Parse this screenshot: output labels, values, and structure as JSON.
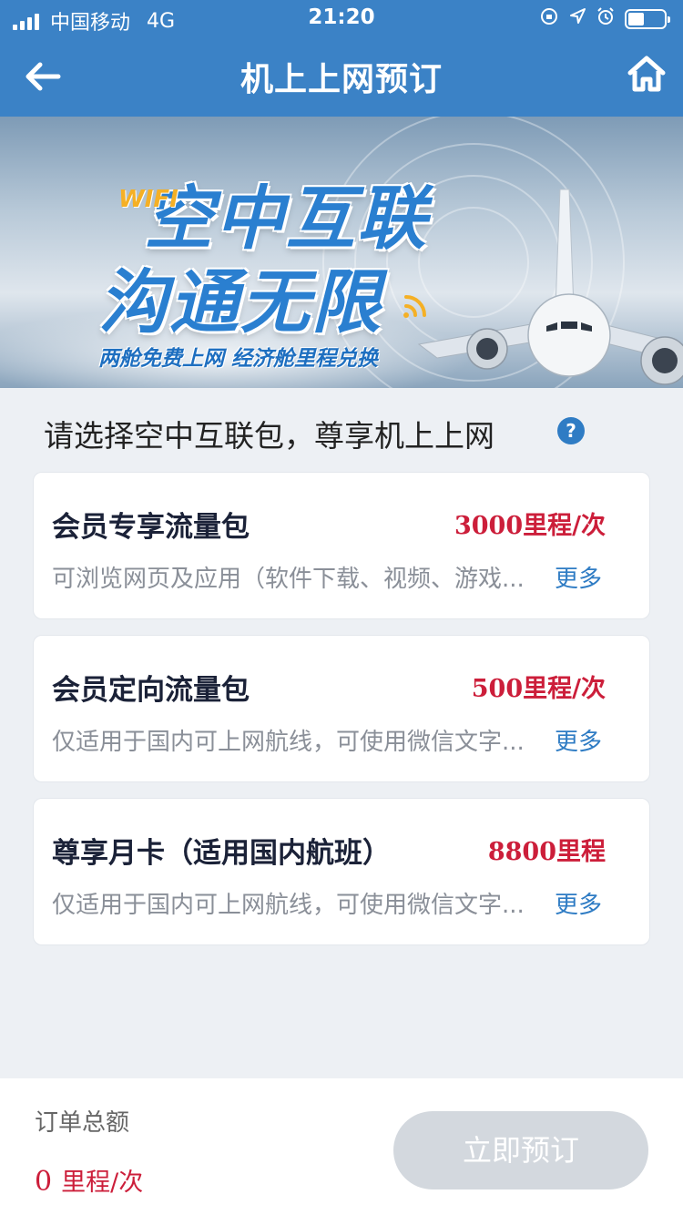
{
  "status_bar": {
    "carrier": "中国移动",
    "network": "4G",
    "time": "21:20"
  },
  "nav": {
    "title": "机上上网预订",
    "back_icon": "arrow-left-icon",
    "home_icon": "home-icon"
  },
  "banner": {
    "wifi_tag": "WIFI",
    "headline_1": "空中互联",
    "headline_2": "沟通无限",
    "subtitle": "两舱免费上网 经济舱里程兑换"
  },
  "section": {
    "title": "请选择空中互联包，尊享机上上网",
    "help_icon": "?"
  },
  "packages": [
    {
      "name": "会员专享流量包",
      "price": "3000里程/次",
      "description": "可浏览网页及应用（软件下载、视频、游戏...",
      "more": "更多"
    },
    {
      "name": "会员定向流量包",
      "price": "500里程/次",
      "description": "仅适用于国内可上网航线，可使用微信文字...",
      "more": "更多"
    },
    {
      "name": "尊享月卡（适用国内航班）",
      "price": "8800里程",
      "description": "仅适用于国内可上网航线，可使用微信文字...",
      "more": "更多"
    }
  ],
  "order": {
    "total_label": "订单总额",
    "total_value": "0",
    "total_unit": "里程/次",
    "book_button": "立即预订"
  },
  "colors": {
    "brand_blue": "#3b82c6",
    "price_red": "#cc1e3a",
    "link_blue": "#2f7cc4",
    "disabled_button": "#d3d8de"
  }
}
